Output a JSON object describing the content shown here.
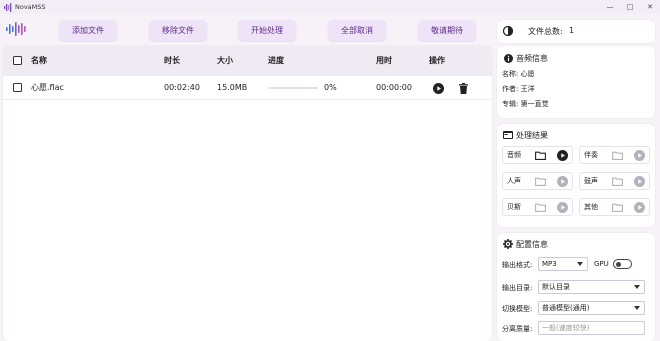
{
  "window": {
    "title": "NovaMSS"
  },
  "toolbar": {
    "add_label": "添加文件",
    "remove_label": "移除文件",
    "start_label": "开始处理",
    "cancel_all_label": "全部取消",
    "coming_label": "敬请期待"
  },
  "file_table": {
    "headers": {
      "name": "名称",
      "duration": "时长",
      "size": "大小",
      "progress": "进度",
      "time": "用时",
      "action": "操作"
    },
    "rows": [
      {
        "name": "心愿.flac",
        "duration": "00:02:40",
        "size": "15.0MB",
        "progress_value": 0,
        "progress_text": "0%",
        "time": "00:00:00"
      }
    ]
  },
  "file_count": {
    "label": "文件总数:",
    "value": "1"
  },
  "audio_info": {
    "title": "音频信息",
    "name_line": "名称:  心愿",
    "author_line": "作者:  王洋",
    "album_line": "专辑:  第一直觉"
  },
  "results": {
    "title": "处理结果",
    "items": [
      {
        "label": "音频",
        "active": true
      },
      {
        "label": "伴奏",
        "active": false
      },
      {
        "label": "人声",
        "active": false
      },
      {
        "label": "鼓声",
        "active": false
      },
      {
        "label": "贝斯",
        "active": false
      },
      {
        "label": "其他",
        "active": false
      }
    ]
  },
  "config": {
    "title": "配置信息",
    "format_label": "输出格式:",
    "format_value": "MP3",
    "gpu_label": "GPU",
    "output_dir_label": "输出目录:",
    "output_dir_value": "默认目录",
    "model_label": "切换模型:",
    "model_value": "普通模型(通用)",
    "quality_label": "分离质量:",
    "quality_value": "一般(速度较快)"
  },
  "colors": {
    "accent": "#6a3ea1",
    "button_bg": "#efe4f7",
    "button_text": "#5b2a86",
    "window_bg": "#f6f2f8"
  }
}
